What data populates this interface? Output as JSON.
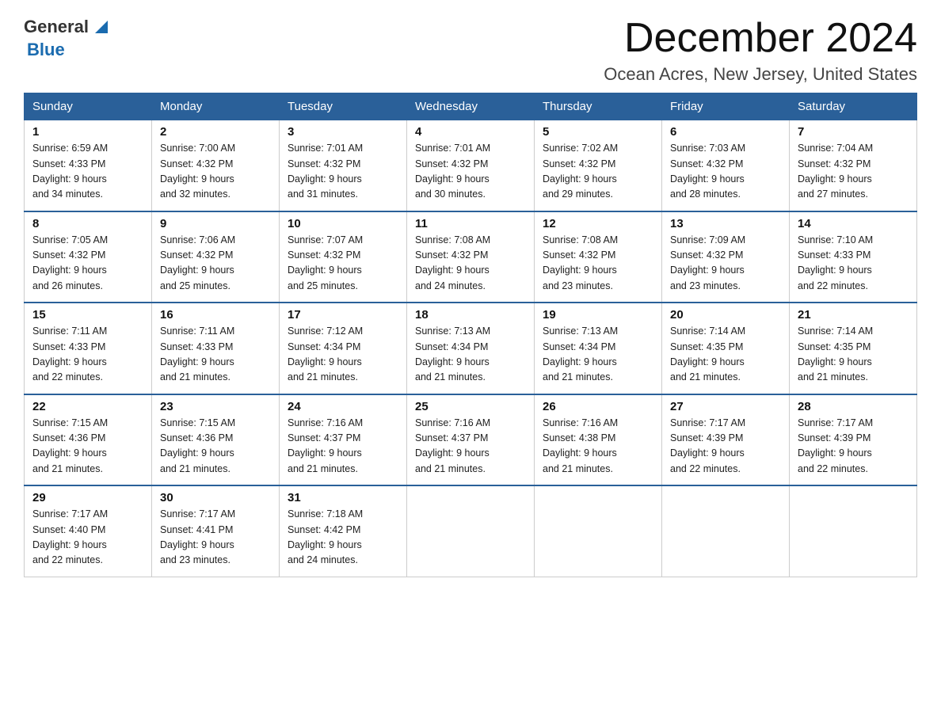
{
  "header": {
    "month_year": "December 2024",
    "location": "Ocean Acres, New Jersey, United States"
  },
  "logo": {
    "general": "General",
    "blue": "Blue"
  },
  "days_of_week": [
    "Sunday",
    "Monday",
    "Tuesday",
    "Wednesday",
    "Thursday",
    "Friday",
    "Saturday"
  ],
  "weeks": [
    [
      {
        "day": "1",
        "sunrise": "6:59 AM",
        "sunset": "4:33 PM",
        "daylight": "9 hours and 34 minutes."
      },
      {
        "day": "2",
        "sunrise": "7:00 AM",
        "sunset": "4:32 PM",
        "daylight": "9 hours and 32 minutes."
      },
      {
        "day": "3",
        "sunrise": "7:01 AM",
        "sunset": "4:32 PM",
        "daylight": "9 hours and 31 minutes."
      },
      {
        "day": "4",
        "sunrise": "7:01 AM",
        "sunset": "4:32 PM",
        "daylight": "9 hours and 30 minutes."
      },
      {
        "day": "5",
        "sunrise": "7:02 AM",
        "sunset": "4:32 PM",
        "daylight": "9 hours and 29 minutes."
      },
      {
        "day": "6",
        "sunrise": "7:03 AM",
        "sunset": "4:32 PM",
        "daylight": "9 hours and 28 minutes."
      },
      {
        "day": "7",
        "sunrise": "7:04 AM",
        "sunset": "4:32 PM",
        "daylight": "9 hours and 27 minutes."
      }
    ],
    [
      {
        "day": "8",
        "sunrise": "7:05 AM",
        "sunset": "4:32 PM",
        "daylight": "9 hours and 26 minutes."
      },
      {
        "day": "9",
        "sunrise": "7:06 AM",
        "sunset": "4:32 PM",
        "daylight": "9 hours and 25 minutes."
      },
      {
        "day": "10",
        "sunrise": "7:07 AM",
        "sunset": "4:32 PM",
        "daylight": "9 hours and 25 minutes."
      },
      {
        "day": "11",
        "sunrise": "7:08 AM",
        "sunset": "4:32 PM",
        "daylight": "9 hours and 24 minutes."
      },
      {
        "day": "12",
        "sunrise": "7:08 AM",
        "sunset": "4:32 PM",
        "daylight": "9 hours and 23 minutes."
      },
      {
        "day": "13",
        "sunrise": "7:09 AM",
        "sunset": "4:32 PM",
        "daylight": "9 hours and 23 minutes."
      },
      {
        "day": "14",
        "sunrise": "7:10 AM",
        "sunset": "4:33 PM",
        "daylight": "9 hours and 22 minutes."
      }
    ],
    [
      {
        "day": "15",
        "sunrise": "7:11 AM",
        "sunset": "4:33 PM",
        "daylight": "9 hours and 22 minutes."
      },
      {
        "day": "16",
        "sunrise": "7:11 AM",
        "sunset": "4:33 PM",
        "daylight": "9 hours and 21 minutes."
      },
      {
        "day": "17",
        "sunrise": "7:12 AM",
        "sunset": "4:34 PM",
        "daylight": "9 hours and 21 minutes."
      },
      {
        "day": "18",
        "sunrise": "7:13 AM",
        "sunset": "4:34 PM",
        "daylight": "9 hours and 21 minutes."
      },
      {
        "day": "19",
        "sunrise": "7:13 AM",
        "sunset": "4:34 PM",
        "daylight": "9 hours and 21 minutes."
      },
      {
        "day": "20",
        "sunrise": "7:14 AM",
        "sunset": "4:35 PM",
        "daylight": "9 hours and 21 minutes."
      },
      {
        "day": "21",
        "sunrise": "7:14 AM",
        "sunset": "4:35 PM",
        "daylight": "9 hours and 21 minutes."
      }
    ],
    [
      {
        "day": "22",
        "sunrise": "7:15 AM",
        "sunset": "4:36 PM",
        "daylight": "9 hours and 21 minutes."
      },
      {
        "day": "23",
        "sunrise": "7:15 AM",
        "sunset": "4:36 PM",
        "daylight": "9 hours and 21 minutes."
      },
      {
        "day": "24",
        "sunrise": "7:16 AM",
        "sunset": "4:37 PM",
        "daylight": "9 hours and 21 minutes."
      },
      {
        "day": "25",
        "sunrise": "7:16 AM",
        "sunset": "4:37 PM",
        "daylight": "9 hours and 21 minutes."
      },
      {
        "day": "26",
        "sunrise": "7:16 AM",
        "sunset": "4:38 PM",
        "daylight": "9 hours and 21 minutes."
      },
      {
        "day": "27",
        "sunrise": "7:17 AM",
        "sunset": "4:39 PM",
        "daylight": "9 hours and 22 minutes."
      },
      {
        "day": "28",
        "sunrise": "7:17 AM",
        "sunset": "4:39 PM",
        "daylight": "9 hours and 22 minutes."
      }
    ],
    [
      {
        "day": "29",
        "sunrise": "7:17 AM",
        "sunset": "4:40 PM",
        "daylight": "9 hours and 22 minutes."
      },
      {
        "day": "30",
        "sunrise": "7:17 AM",
        "sunset": "4:41 PM",
        "daylight": "9 hours and 23 minutes."
      },
      {
        "day": "31",
        "sunrise": "7:18 AM",
        "sunset": "4:42 PM",
        "daylight": "9 hours and 24 minutes."
      },
      null,
      null,
      null,
      null
    ]
  ],
  "labels": {
    "sunrise_prefix": "Sunrise: ",
    "sunset_prefix": "Sunset: ",
    "daylight_prefix": "Daylight: "
  }
}
